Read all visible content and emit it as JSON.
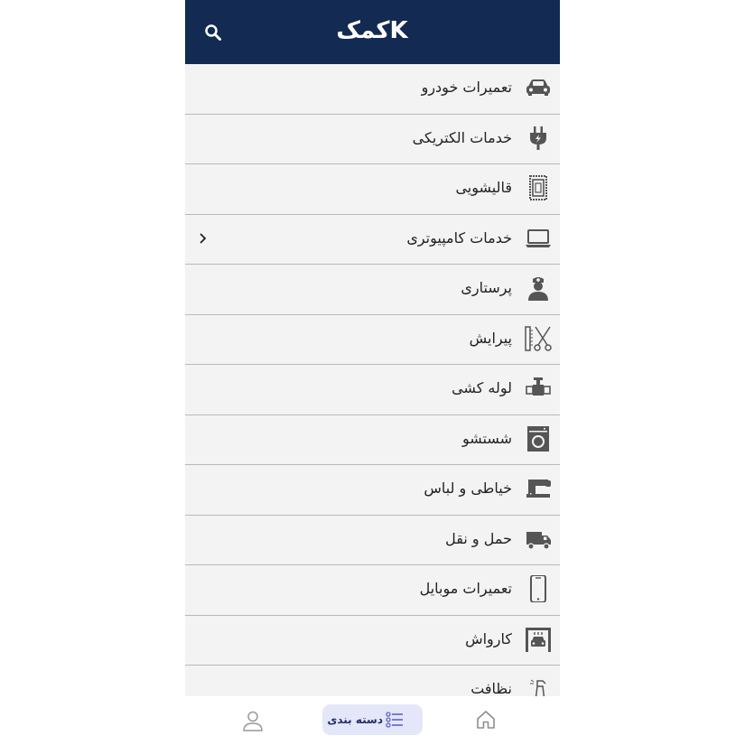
{
  "header": {
    "logo_text": "کمکK",
    "search_icon": "search-icon"
  },
  "categories": [
    {
      "label": "تعمیرات خودرو",
      "icon": "car-icon"
    },
    {
      "label": "خدمات الکتریکی",
      "icon": "electric-plug-icon"
    },
    {
      "label": "قالیشویی",
      "icon": "carpet-icon"
    },
    {
      "label": "خدمات کامپیوتری",
      "icon": "laptop-icon",
      "has_submenu": true,
      "chevron_icon": "chevron-right-icon"
    },
    {
      "label": "پرستاری",
      "icon": "nurse-icon"
    },
    {
      "label": "پیرایش",
      "icon": "scissors-comb-icon"
    },
    {
      "label": "لوله کشی",
      "icon": "pipe-valve-icon"
    },
    {
      "label": "شستشو",
      "icon": "washing-machine-icon"
    },
    {
      "label": "خیاطی و لباس",
      "icon": "sewing-machine-icon"
    },
    {
      "label": "حمل و نقل",
      "icon": "truck-icon"
    },
    {
      "label": "تعمیرات موبایل",
      "icon": "mobile-phone-icon"
    },
    {
      "label": "کارواش",
      "icon": "car-wash-icon"
    },
    {
      "label": "نظافت",
      "icon": "spray-bottle-icon"
    }
  ],
  "bottom_nav": {
    "profile_icon": "user-icon",
    "categories_label": "دسته بندی",
    "categories_icon": "list-icon",
    "home_icon": "home-icon",
    "active": "categories"
  },
  "colors": {
    "header_bg": "#132a52",
    "list_bg": "#f3f3f3",
    "active_tab_bg": "#e4e6f9",
    "icon_gray": "#555555"
  }
}
